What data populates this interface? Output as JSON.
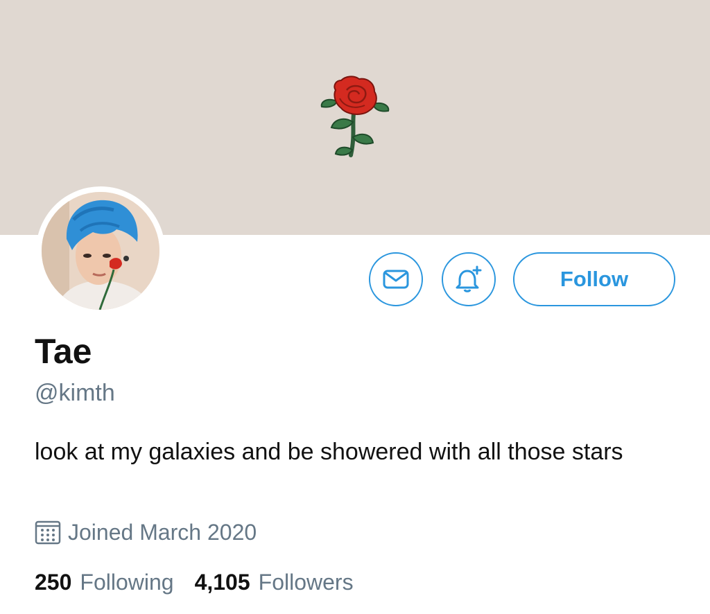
{
  "profile": {
    "name": "Tae",
    "handle": "@kimth",
    "bio": "look at my galaxies and be showered with all those stars",
    "joined": "Joined March 2020"
  },
  "actions": {
    "follow_label": "Follow",
    "message_icon": "envelope-icon",
    "notify_icon": "bell-plus-icon"
  },
  "stats": {
    "following_count": "250",
    "following_label": "Following",
    "followers_count": "4,105",
    "followers_label": "Followers"
  },
  "colors": {
    "accent": "#2a96de",
    "banner": "#e0d8d1",
    "secondary_text": "#657786"
  }
}
